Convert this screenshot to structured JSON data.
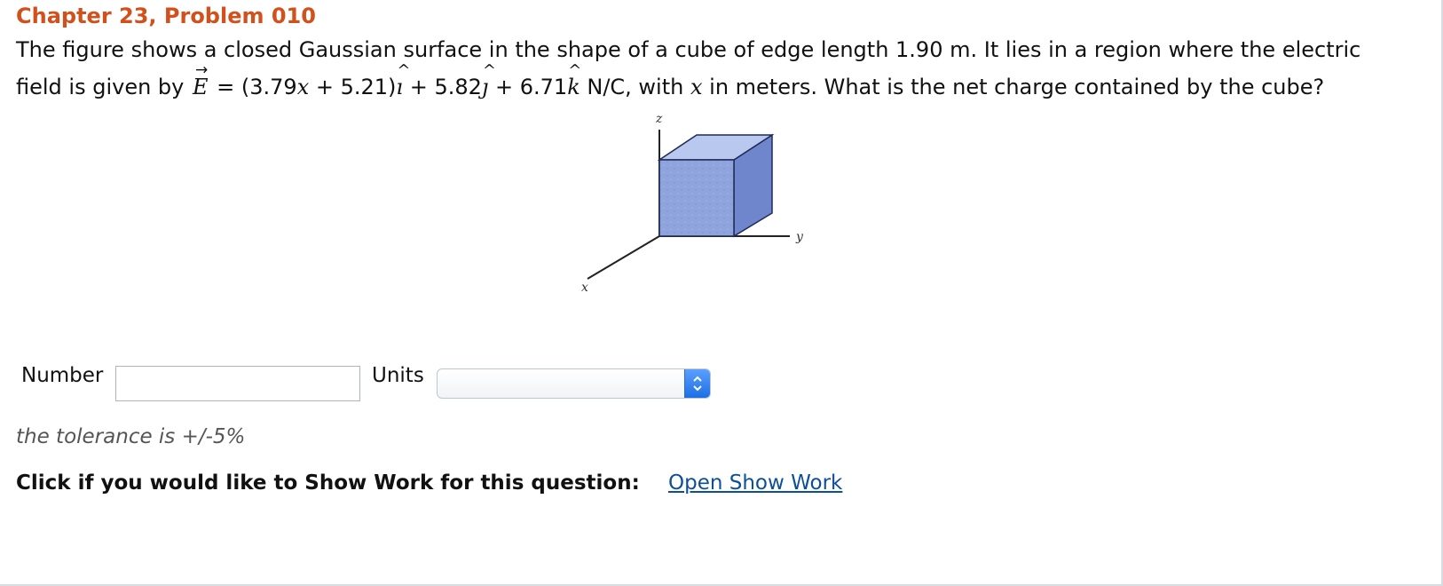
{
  "problem": {
    "title": "Chapter 23, Problem 010",
    "line1": "The figure shows a closed Gaussian surface in the shape of a cube of edge length 1.90 m. It lies in a region where the electric",
    "line2_prefix": "field is given by ",
    "vector": "E",
    "equals": " = (3.79",
    "x_var": "x",
    "after_x": " + 5.21)",
    "i_hat": "ı",
    "plus_j": " + 5.82",
    "j_hat": "ȷ",
    "plus_k": " + 6.71",
    "k_hat": "k",
    "unit_with": " N/C, with ",
    "x_var2": "x",
    "suffix": " in meters. What is the net charge contained by the cube?"
  },
  "figure": {
    "z_label": "z",
    "y_label": "y",
    "x_label": "x"
  },
  "answer": {
    "number_label": "Number",
    "number_value": "",
    "units_label": "Units",
    "units_selected": ""
  },
  "tolerance": "the tolerance is +/-5%",
  "show_work": {
    "prompt": "Click if you would like to Show Work for this question:",
    "link": "Open Show Work"
  },
  "colors": {
    "title": "#d2501c",
    "link": "#0d4f99",
    "cube_front": "#8fa3dc",
    "cube_top": "#b9c8ee",
    "cube_side": "#6f86cc"
  },
  "icons": {
    "vector_arrow": "right-arrow-icon",
    "select_stepper": "up-down-chevrons-icon"
  }
}
